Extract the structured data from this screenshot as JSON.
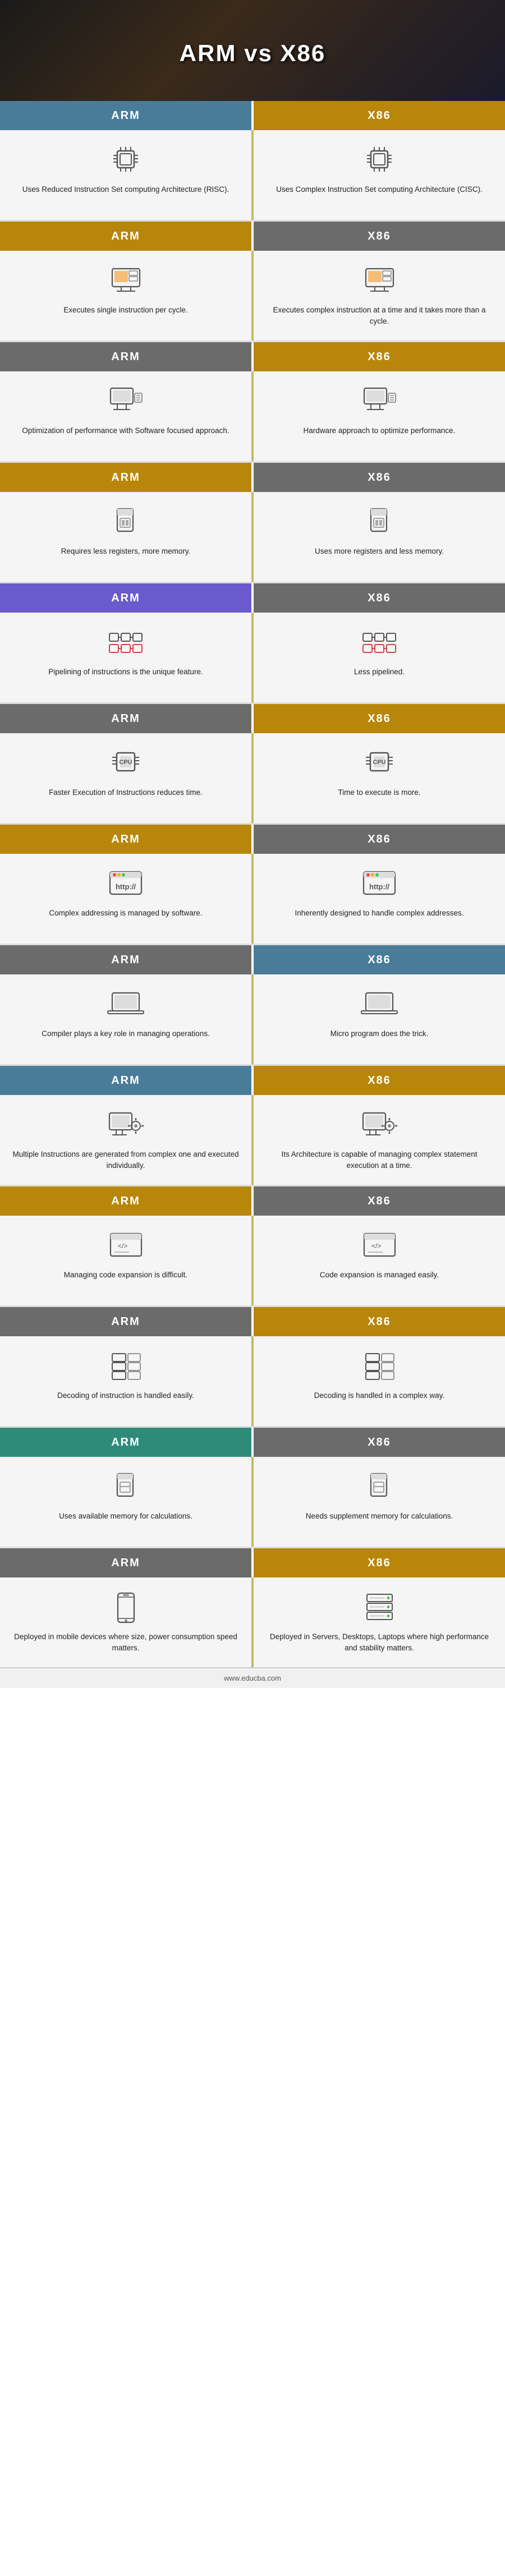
{
  "header": {
    "title": "ARM vs X86"
  },
  "label": {
    "arm": "ARM",
    "x86": "X86"
  },
  "rows": [
    {
      "bar_color_arm": "#4a7c99",
      "bar_color_x86": "#b8860b",
      "arm_text": "Uses Reduced Instruction Set computing Architecture (RISC).",
      "x86_text": "Uses Complex Instruction Set computing Architecture (CISC).",
      "arm_icon": "cpu",
      "x86_icon": "cpu"
    },
    {
      "bar_color_arm": "#b8860b",
      "bar_color_x86": "#6b6b6b",
      "arm_text": "Executes single instruction per cycle.",
      "x86_text": "Executes complex instruction at a time and it takes more than a cycle.",
      "arm_icon": "monitor-orange",
      "x86_icon": "monitor-orange"
    },
    {
      "bar_color_arm": "#6b6b6b",
      "bar_color_x86": "#b8860b",
      "arm_text": "Optimization of performance with Software focused approach.",
      "x86_text": "Hardware approach to optimize performance.",
      "arm_icon": "computer",
      "x86_icon": "computer"
    },
    {
      "bar_color_arm": "#b8860b",
      "bar_color_x86": "#6b6b6b",
      "arm_text": "Requires less registers, more memory.",
      "x86_text": "Uses more registers and less memory.",
      "arm_icon": "simcard",
      "x86_icon": "simcard"
    },
    {
      "bar_color_arm": "#6a5acd",
      "bar_color_x86": "#6b6b6b",
      "arm_text": "Pipelining of instructions is the unique feature.",
      "x86_text": "Less pipelined.",
      "arm_icon": "pipeline",
      "x86_icon": "pipeline"
    },
    {
      "bar_color_arm": "#6b6b6b",
      "bar_color_x86": "#b8860b",
      "arm_text": "Faster Execution of Instructions reduces time.",
      "x86_text": "Time to execute is more.",
      "arm_icon": "chip",
      "x86_icon": "chip"
    },
    {
      "bar_color_arm": "#b8860b",
      "bar_color_x86": "#6b6b6b",
      "arm_text": "Complex addressing is managed by software.",
      "x86_text": "Inherently designed to handle complex addresses.",
      "arm_icon": "http",
      "x86_icon": "http"
    },
    {
      "bar_color_arm": "#6b6b6b",
      "bar_color_x86": "#4a7c99",
      "arm_text": "Compiler plays a key role in managing operations.",
      "x86_text": "Micro program does the trick.",
      "arm_icon": "laptop",
      "x86_icon": "laptop"
    },
    {
      "bar_color_arm": "#4a7c99",
      "bar_color_x86": "#b8860b",
      "arm_text": "Multiple Instructions are generated from complex one and executed individually.",
      "x86_text": "Its Architecture is capable of managing complex statement execution at a time.",
      "arm_icon": "gear-monitor",
      "x86_icon": "gear-monitor"
    },
    {
      "bar_color_arm": "#b8860b",
      "bar_color_x86": "#6b6b6b",
      "arm_text": "Managing code expansion is difficult.",
      "x86_text": "Code expansion is managed easily.",
      "arm_icon": "code",
      "x86_icon": "code"
    },
    {
      "bar_color_arm": "#6b6b6b",
      "bar_color_x86": "#b8860b",
      "arm_text": "Decoding of instruction is handled easily.",
      "x86_text": "Decoding is handled in a complex way.",
      "arm_icon": "layers",
      "x86_icon": "layers"
    },
    {
      "bar_color_arm": "#2e8b7a",
      "bar_color_x86": "#6b6b6b",
      "arm_text": "Uses available memory for calculations.",
      "x86_text": "Needs supplement memory for calculations.",
      "arm_icon": "simcard2",
      "x86_icon": "simcard2"
    },
    {
      "bar_color_arm": "#6b6b6b",
      "bar_color_x86": "#b8860b",
      "arm_text": "Deployed in mobile devices where size, power consumption speed matters.",
      "x86_text": "Deployed in Servers, Desktops, Laptops where high performance and stability matters.",
      "arm_icon": "mobile",
      "x86_icon": "server"
    }
  ],
  "footer": {
    "url": "www.educba.com"
  }
}
